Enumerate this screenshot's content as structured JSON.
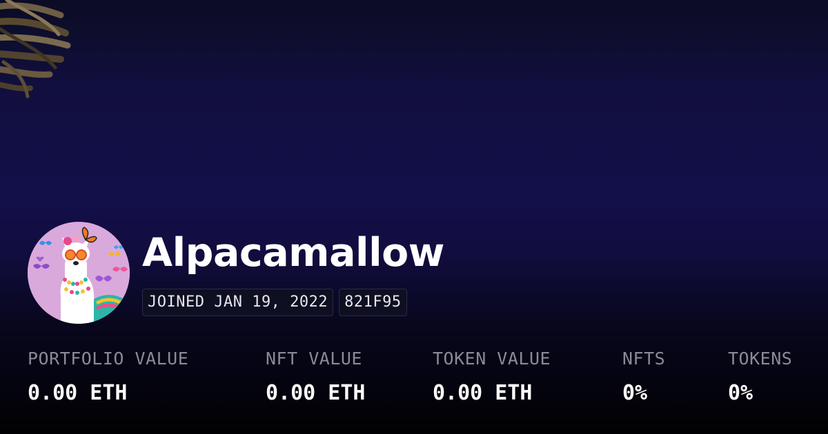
{
  "profile": {
    "username": "Alpacamallow",
    "joined": "JOINED JAN 19, 2022",
    "address": "821F95"
  },
  "stats": [
    {
      "label": "PORTFOLIO VALUE",
      "value": "0.00 ETH"
    },
    {
      "label": "NFT VALUE",
      "value": "0.00 ETH"
    },
    {
      "label": "TOKEN VALUE",
      "value": "0.00 ETH"
    },
    {
      "label": "NFTS",
      "value": "0%"
    },
    {
      "label": "TOKENS",
      "value": "0%"
    }
  ],
  "icons": {
    "avatar": "alpaca-avatar",
    "corner": "decorative-nest-art"
  },
  "colors": {
    "background_top": "#0b0c24",
    "background_mid": "#130f4a",
    "background_bottom": "#010103",
    "label": "#8a8b96",
    "value": "#ffffff",
    "avatar_bg": "#d9a9dc"
  }
}
